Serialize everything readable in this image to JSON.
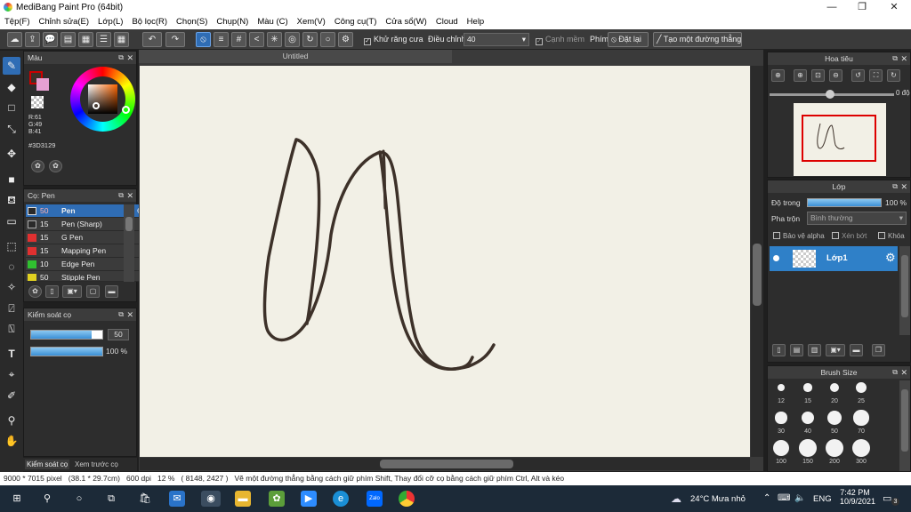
{
  "window": {
    "title": "MediBang Paint Pro (64bit)"
  },
  "menu": [
    "Tệp(F)",
    "Chỉnh sửa(E)",
    "Lớp(L)",
    "Bộ lọc(R)",
    "Chọn(S)",
    "Chụp(N)",
    "Màu (C)",
    "Xem(V)",
    "Công cụ(T)",
    "Cửa sổ(W)",
    "Cloud",
    "Help"
  ],
  "toolbar": {
    "antialias_label": "Khử răng cưa",
    "adjust_label": "Điều chỉnh",
    "adjust_value": "40",
    "edge_label": "Cạnh mềm",
    "key_label": "Phím",
    "reset_label": "Đặt lại",
    "straight_label": "Tạo một đường thẳng"
  },
  "color_panel": {
    "title": "Màu",
    "r": "R:61",
    "g": "G:49",
    "b": "B:41",
    "hex": "#3D3129",
    "primary_color": "#3D3129",
    "secondary_color": "#E6A0D2"
  },
  "brush_panel": {
    "title": "Cọ: Pen",
    "items": [
      {
        "size": "50",
        "name": "Pen",
        "color": "#2f6db5"
      },
      {
        "size": "15",
        "name": "Pen (Sharp)",
        "color": "#2a2a2a"
      },
      {
        "size": "15",
        "name": "G Pen",
        "color": "#e03030"
      },
      {
        "size": "15",
        "name": "Mapping Pen",
        "color": "#e03030"
      },
      {
        "size": "10",
        "name": "Edge Pen",
        "color": "#30c030"
      },
      {
        "size": "50",
        "name": "Stipple Pen",
        "color": "#e0d020"
      }
    ]
  },
  "brush_control": {
    "title": "Kiểm soát cọ",
    "size_value": "50",
    "opacity_value": "100 %",
    "size_fraction": 0.85,
    "opacity_fraction": 1.0
  },
  "bottom_tabs": [
    "Kiểm soát cọ",
    "Xem trước cọ"
  ],
  "canvas": {
    "tab_title": "Untitled",
    "stroke_color": "#3D3129"
  },
  "navigator": {
    "title": "Hoa tiêu",
    "rotation": "0 độ"
  },
  "layer_panel": {
    "title": "Lớp",
    "opacity_label": "Độ trong",
    "opacity_value": "100 %",
    "opacity_fraction": 1.0,
    "blend_label": "Pha trộn",
    "blend_value": "Bình thường",
    "protect_alpha": "Bảo vệ alpha",
    "clipping": "Xén bớt",
    "lock": "Khóa",
    "layer_name": "Lớp1"
  },
  "brush_size_panel": {
    "title": "Brush Size",
    "sizes": [
      "12",
      "15",
      "20",
      "25",
      "30",
      "40",
      "50",
      "70",
      "100",
      "150",
      "200",
      "300"
    ]
  },
  "status": {
    "dims": "9000 * 7015 pixel",
    "cm": "(38.1 * 29.7cm)",
    "dpi": "600 dpi",
    "zoom": "12 %",
    "coords": "( 8148, 2427 )",
    "hint": "Vẽ một đường thẳng bằng cách giữ phím Shift, Thay đổi cỡ cọ bằng cách giữ phím Ctrl, Alt và kéo"
  },
  "taskbar": {
    "weather": "24°C  Mưa nhỏ",
    "lang": "ENG",
    "time": "7:42 PM",
    "date": "10/9/2021",
    "notif_count": "3"
  }
}
